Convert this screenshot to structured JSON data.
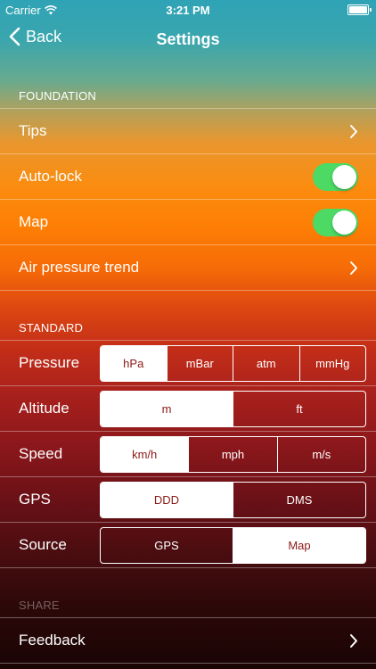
{
  "status_bar": {
    "carrier": "Carrier",
    "time": "3:21 PM"
  },
  "nav": {
    "back_label": "Back",
    "title": "Settings"
  },
  "sections": {
    "foundation": "FOUNDATION",
    "standard": "STANDARD",
    "share": "SHARE"
  },
  "foundation_rows": {
    "tips": "Tips",
    "auto_lock": {
      "label": "Auto-lock",
      "on": true
    },
    "map": {
      "label": "Map",
      "on": true
    },
    "air_pressure_trend": "Air pressure trend"
  },
  "standard_rows": {
    "pressure": {
      "label": "Pressure",
      "options": [
        "hPa",
        "mBar",
        "atm",
        "mmHg"
      ],
      "selected": "hPa"
    },
    "altitude": {
      "label": "Altitude",
      "options": [
        "m",
        "ft"
      ],
      "selected": "m"
    },
    "speed": {
      "label": "Speed",
      "options": [
        "km/h",
        "mph",
        "m/s"
      ],
      "selected": "km/h"
    },
    "gps": {
      "label": "GPS",
      "options": [
        "DDD",
        "DMS"
      ],
      "selected": "DDD"
    },
    "source": {
      "label": "Source",
      "options": [
        "GPS",
        "Map"
      ],
      "selected": "Map"
    }
  },
  "share_rows": {
    "feedback": "Feedback"
  },
  "colors": {
    "toggle_on": "#4cd964",
    "selected_segment_text": "#8b1a17"
  }
}
